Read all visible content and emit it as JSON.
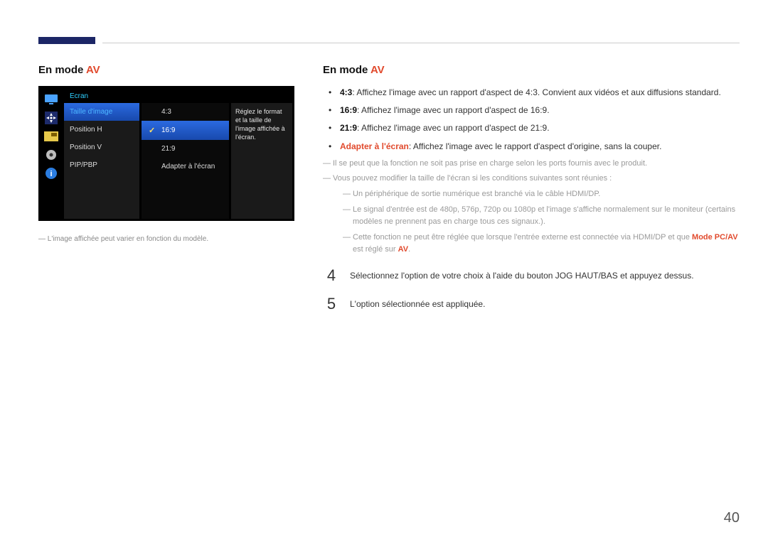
{
  "page_number": "40",
  "heading": {
    "prefix": "En mode ",
    "suffix": "AV"
  },
  "osd": {
    "title": "Ecran",
    "col1": [
      "Taille d'image",
      "Position H",
      "Position V",
      "PIP/PBP"
    ],
    "col2": [
      "4:3",
      "16:9",
      "21:9",
      "Adapter à l'écran"
    ],
    "col3": "Réglez le format et la taille de l'image affichée à l'écran."
  },
  "caption_left": "L'image affichée peut varier en fonction du modèle.",
  "bullets": [
    {
      "strong": "4:3",
      "text": ": Affichez l'image avec un rapport d'aspect de 4:3. Convient aux vidéos et aux diffusions standard."
    },
    {
      "strong": "16:9",
      "text": ": Affichez l'image avec un rapport d'aspect de 16:9."
    },
    {
      "strong": "21:9",
      "text": ": Affichez l'image avec un rapport d'aspect de 21:9."
    },
    {
      "strong_red": "Adapter à l'écran",
      "text": ": Affichez l'image avec le rapport d'aspect d'origine, sans la couper."
    }
  ],
  "note1": "Il se peut que la fonction ne soit pas prise en charge selon les ports fournis avec le produit.",
  "note2": "Vous pouvez modifier la taille de l'écran si les conditions suivantes sont réunies :",
  "sub1": "Un périphérique de sortie numérique est branché via le câble HDMI/DP.",
  "sub2": "Le signal d'entrée est de 480p, 576p, 720p ou 1080p et l'image s'affiche normalement sur le moniteur (certains modèles ne prennent pas en charge tous ces signaux.).",
  "sub3_a": "Cette fonction ne peut être réglée que lorsque l'entrée externe est connectée via HDMI/DP et que ",
  "sub3_b": "Mode PC/AV",
  "sub3_c": " est réglé sur ",
  "sub3_d": "AV",
  "sub3_e": ".",
  "steps": {
    "4": {
      "num": "4",
      "text": "Sélectionnez l'option de votre choix à l'aide du bouton JOG HAUT/BAS et appuyez dessus."
    },
    "5": {
      "num": "5",
      "text": "L'option sélectionnée est appliquée."
    }
  }
}
